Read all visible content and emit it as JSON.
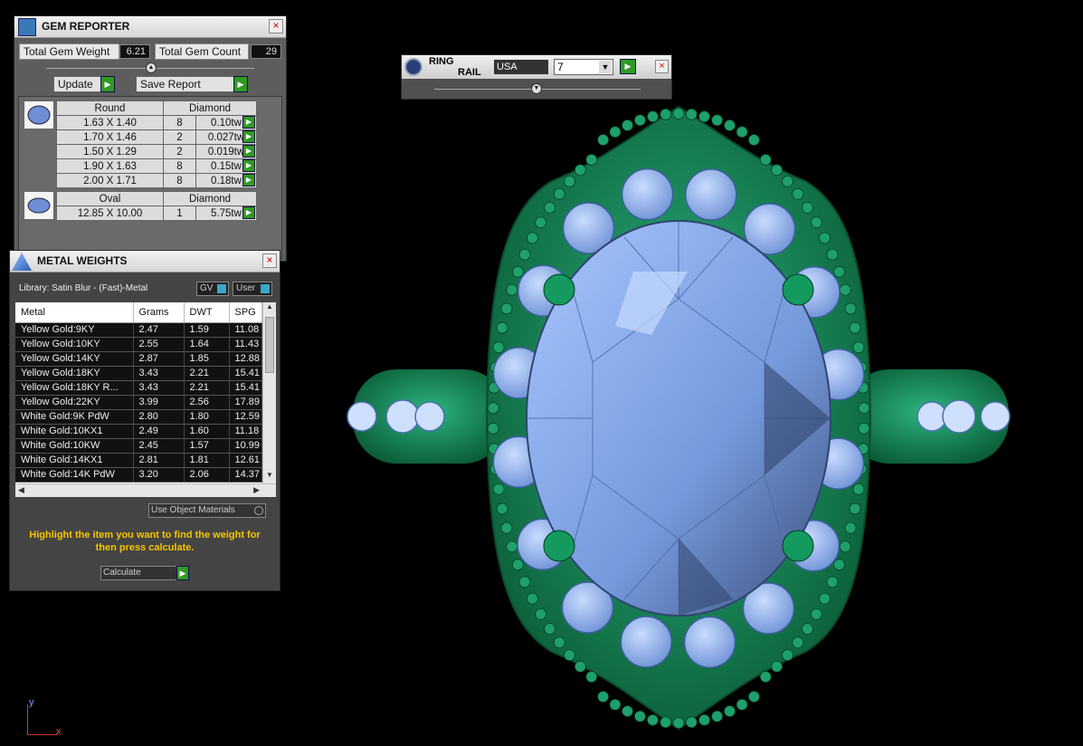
{
  "gem_reporter": {
    "title": "GEM REPORTER",
    "total_weight_label": "Total Gem Weight",
    "total_weight_value": "6.21",
    "total_count_label": "Total Gem Count",
    "total_count_value": "29",
    "update_label": "Update",
    "save_report_label": "Save Report",
    "groups": [
      {
        "shape": "Round",
        "type": "Diamond",
        "rows": [
          {
            "size": "1.63 X 1.40",
            "count": "8",
            "weight": "0.10tw"
          },
          {
            "size": "1.70 X 1.46",
            "count": "2",
            "weight": "0.027tw"
          },
          {
            "size": "1.50 X 1.29",
            "count": "2",
            "weight": "0.019tw"
          },
          {
            "size": "1.90 X 1.63",
            "count": "8",
            "weight": "0.15tw"
          },
          {
            "size": "2.00 X 1.71",
            "count": "8",
            "weight": "0.18tw"
          }
        ]
      },
      {
        "shape": "Oval",
        "type": "Diamond",
        "rows": [
          {
            "size": "12.85 X 10.00",
            "count": "1",
            "weight": "5.75tw"
          }
        ]
      }
    ]
  },
  "ring_rail": {
    "title_line1": "RING",
    "title_line2": "RAIL",
    "region": "USA",
    "size": "7"
  },
  "metal_weights": {
    "title": "METAL WEIGHTS",
    "library": "Library: Satin Blur - (Fast)-Metal",
    "gv_label": "GV",
    "user_label": "User",
    "columns": [
      "Metal",
      "Grams",
      "DWT",
      "SPG"
    ],
    "rows": [
      [
        "Yellow Gold:9KY",
        "2.47",
        "1.59",
        "11.08"
      ],
      [
        "Yellow Gold:10KY",
        "2.55",
        "1.64",
        "11.43"
      ],
      [
        "Yellow Gold:14KY",
        "2.87",
        "1.85",
        "12.88"
      ],
      [
        "Yellow Gold:18KY",
        "3.43",
        "2.21",
        "15.41"
      ],
      [
        "Yellow Gold:18KY R...",
        "3.43",
        "2.21",
        "15.41"
      ],
      [
        "Yellow Gold:22KY",
        "3.99",
        "2.56",
        "17.89"
      ],
      [
        "White Gold:9K PdW",
        "2.80",
        "1.80",
        "12.59"
      ],
      [
        "White Gold:10KX1",
        "2.49",
        "1.60",
        "11.18"
      ],
      [
        "White Gold:10KW",
        "2.45",
        "1.57",
        "10.99"
      ],
      [
        "White Gold:14KX1",
        "2.81",
        "1.81",
        "12.61"
      ],
      [
        "White Gold:14K PdW",
        "3.20",
        "2.06",
        "14.37"
      ]
    ],
    "use_object_materials": "Use Object Materials",
    "instructions": "Highlight the item you want to find the weight for then press calculate.",
    "calculate_label": "Calculate"
  },
  "axis": {
    "y": "y",
    "x": "x"
  },
  "colors": {
    "metal_green": "#0e7a4a",
    "gem_blue": "#7fa6e8",
    "accent_yellow": "#f5c400"
  }
}
